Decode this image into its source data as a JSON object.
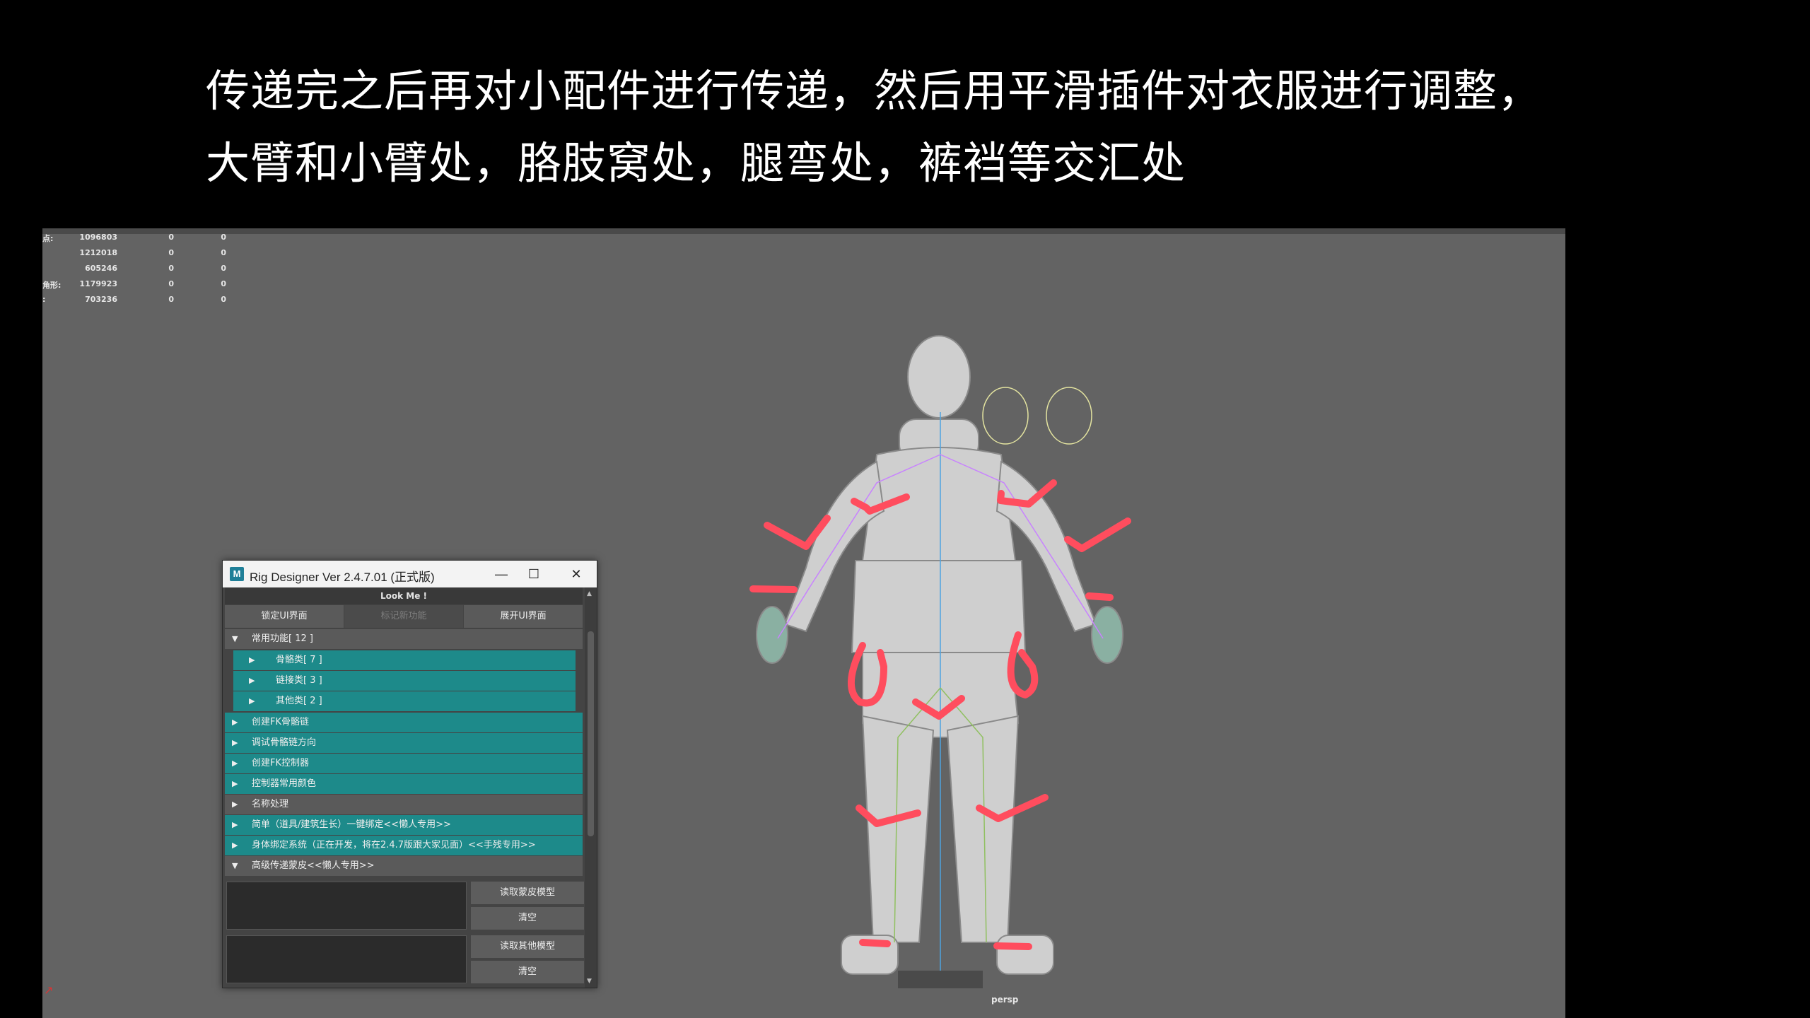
{
  "caption": {
    "line1": "传递完之后再对小配件进行传递，然后用平滑插件对衣服进行调整，",
    "line2": "大臂和小臂处，胳肢窝处，腿弯处，裤裆等交汇处"
  },
  "viewport": {
    "stats": [
      {
        "label": "点:",
        "v1": "1096803",
        "v2": "0",
        "v3": "0"
      },
      {
        "label": "",
        "v1": "1212018",
        "v2": "0",
        "v3": "0"
      },
      {
        "label": "",
        "v1": "605246",
        "v2": "0",
        "v3": "0"
      },
      {
        "label": "角形:",
        "v1": "1179923",
        "v2": "0",
        "v3": "0"
      },
      {
        "label": ":",
        "v1": "703236",
        "v2": "0",
        "v3": "0"
      }
    ],
    "camera_label": "persp",
    "annotation_color": "#ff4d5e"
  },
  "rig_window": {
    "app_icon": "M",
    "title": "Rig Designer Ver 2.4.7.01 (正式版)",
    "minimize": "—",
    "maximize": "☐",
    "close": "✕",
    "look_me": "Look Me !",
    "lock_ui": "锁定UI界面",
    "mark_new": "标记新功能",
    "expand_ui": "展开UI界面",
    "sections": [
      {
        "label": "常用功能[ 12 ]",
        "style": "gray",
        "expanded": true,
        "sub": false
      },
      {
        "label": "骨骼类[ 7 ]",
        "style": "teal",
        "expanded": false,
        "sub": true
      },
      {
        "label": "链接类[ 3 ]",
        "style": "teal",
        "expanded": false,
        "sub": true
      },
      {
        "label": "其他类[ 2 ]",
        "style": "teal",
        "expanded": false,
        "sub": true
      },
      {
        "label": "创建FK骨骼链",
        "style": "teal",
        "expanded": false,
        "sub": false
      },
      {
        "label": "调试骨骼链方向",
        "style": "teal",
        "expanded": false,
        "sub": false
      },
      {
        "label": "创建FK控制器",
        "style": "teal",
        "expanded": false,
        "sub": false
      },
      {
        "label": "控制器常用颜色",
        "style": "teal",
        "expanded": false,
        "sub": false
      },
      {
        "label": "名称处理",
        "style": "gray",
        "expanded": false,
        "sub": false
      },
      {
        "label": "简单（道具/建筑生长）一键绑定<<懒人专用>>",
        "style": "teal",
        "expanded": false,
        "sub": false
      },
      {
        "label": "身体绑定系统（正在开发，将在2.4.7版跟大家见面）<<手残专用>>",
        "style": "teal",
        "expanded": false,
        "sub": false
      },
      {
        "label": "高级传递蒙皮<<懒人专用>>",
        "style": "gray",
        "expanded": true,
        "sub": false
      }
    ],
    "read_skin_model": "读取蒙皮模型",
    "clear1": "清空",
    "read_other_model": "读取其他模型",
    "clear2": "清空"
  }
}
